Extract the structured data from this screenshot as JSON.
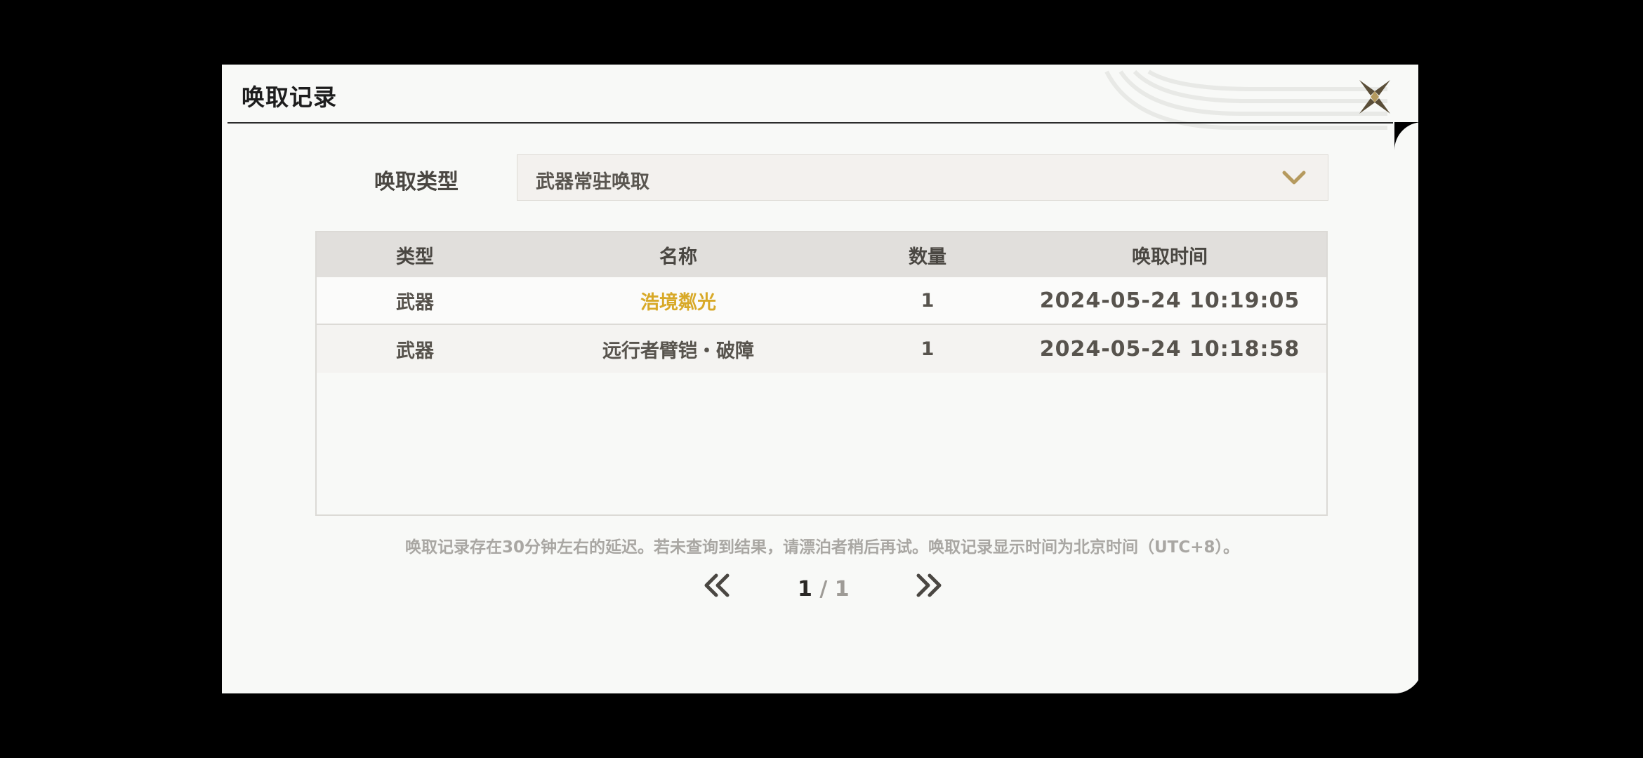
{
  "dialog": {
    "title": "唤取记录"
  },
  "filter": {
    "label": "唤取类型",
    "selected": "武器常驻唤取"
  },
  "table": {
    "columns": [
      "类型",
      "名称",
      "数量",
      "唤取时间"
    ],
    "rows": [
      {
        "type": "武器",
        "name": "浩境粼光",
        "quantity": "1",
        "time": "2024-05-24 10:19:05",
        "name_color": "#d8a928"
      },
      {
        "type": "武器",
        "name": "远行者臂铠・破障",
        "quantity": "1",
        "time": "2024-05-24 10:18:58",
        "name_color": "#57534d"
      }
    ]
  },
  "notice": "唤取记录存在30分钟左右的延迟。若未查询到结果，请漂泊者稍后再试。唤取记录显示时间为北京时间（UTC+8）。",
  "pagination": {
    "current": "1",
    "separator": " / ",
    "total": "1"
  },
  "icons": {
    "close": "close-x-icon",
    "dropdown": "chevron-down-icon",
    "prev": "double-chevron-left-icon",
    "next": "double-chevron-right-icon"
  },
  "colors": {
    "accent_gold": "#d8a928",
    "chevron": "#b59a5e",
    "panel_bg": "#f8f9f7"
  }
}
